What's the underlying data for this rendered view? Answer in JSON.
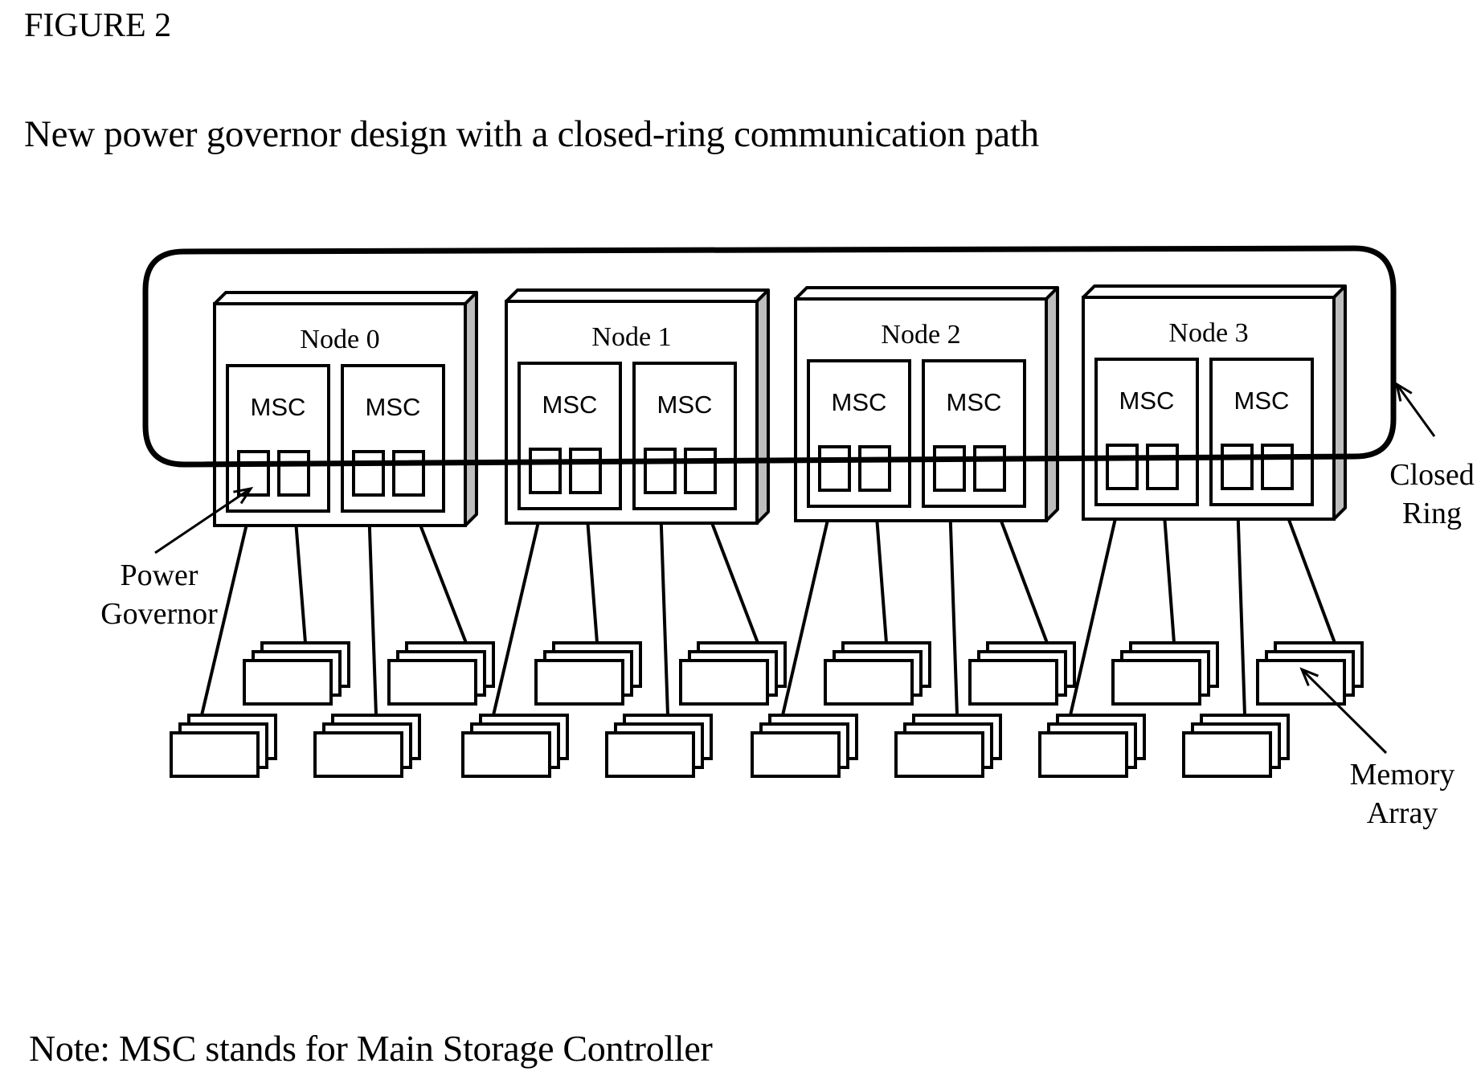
{
  "figure": {
    "title": "FIGURE 2",
    "subtitle": "New power governor design with a closed-ring communication path",
    "note": "Note: MSC stands for Main Storage Controller"
  },
  "diagram": {
    "nodes": [
      {
        "label": "Node 0",
        "controllers": [
          {
            "label": "MSC"
          },
          {
            "label": "MSC"
          }
        ]
      },
      {
        "label": "Node 1",
        "controllers": [
          {
            "label": "MSC"
          },
          {
            "label": "MSC"
          }
        ]
      },
      {
        "label": "Node 2",
        "controllers": [
          {
            "label": "MSC"
          },
          {
            "label": "MSC"
          }
        ]
      },
      {
        "label": "Node 3",
        "controllers": [
          {
            "label": "MSC"
          },
          {
            "label": "MSC"
          }
        ]
      }
    ],
    "ports_per_controller": 2,
    "memory_arrays_per_node": 4,
    "callouts": {
      "power_governor": [
        "Power",
        "Governor"
      ],
      "closed_ring": [
        "Closed",
        "Ring"
      ],
      "memory_array": [
        "Memory",
        "Array"
      ]
    },
    "colors": {
      "line": "#000000",
      "background": "#ffffff",
      "node_side_shade": "#bdbdbd"
    }
  }
}
